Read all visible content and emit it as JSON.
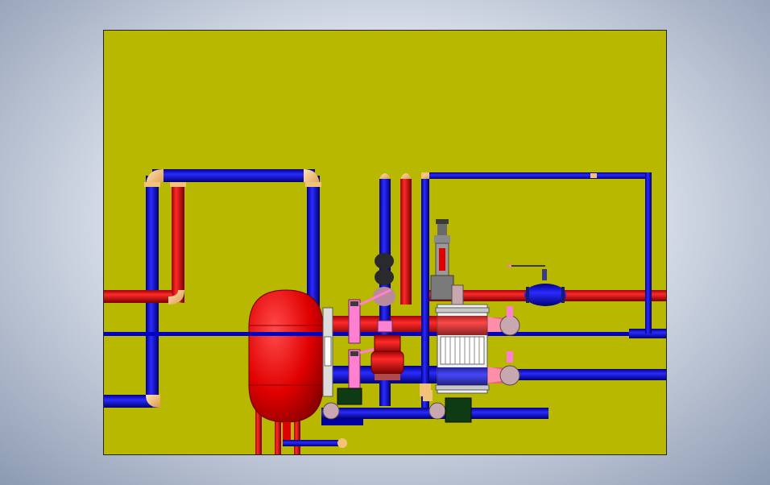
{
  "scene": {
    "background_color": "#b8b800",
    "colors": {
      "hot_pipe": "#e00000",
      "cold_pipe": "#0000c8",
      "elbow": "#f2c27a",
      "tank": "#e00000",
      "valve_pink": "#ff7fd0",
      "flange": "#c8a8b0",
      "pump_green": "#0e3a14",
      "actuator_gray": "#8a8a8a"
    },
    "components": [
      "expansion-tank",
      "plate-heat-exchanger",
      "circulation-pump",
      "ball-valve",
      "control-valve",
      "butterfly-valve",
      "strainer",
      "air-vent"
    ]
  }
}
